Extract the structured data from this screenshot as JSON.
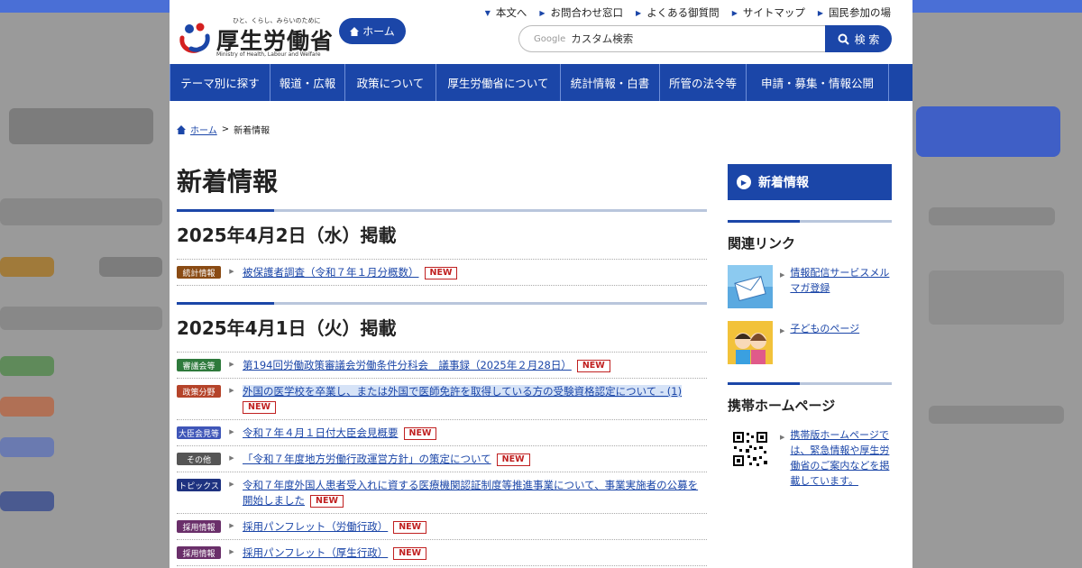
{
  "header": {
    "tagline": "ひと、くらし、みらいのために",
    "logo_name": "厚生労働省",
    "logo_english": "Ministry of Health, Labour and Welfare",
    "home_button": "ホーム",
    "utility_links": [
      "本文へ",
      "お問合わせ窓口",
      "よくある御質問",
      "サイトマップ",
      "国民参加の場"
    ],
    "search_brand": "Google",
    "search_value": "カスタム検索",
    "search_button": "検 索"
  },
  "nav": [
    "テーマ別に探す",
    "報道・広報",
    "政策について",
    "厚生労働省について",
    "統計情報・白書",
    "所管の法令等",
    "申請・募集・情報公開"
  ],
  "breadcrumb": {
    "home": "ホーム",
    "separator": ">",
    "current": "新着情報"
  },
  "main": {
    "title": "新着情報",
    "new_label": "NEW",
    "sections": [
      {
        "date": "2025年4月2日（水）掲載",
        "items": [
          {
            "category": "統計情報",
            "color": "#8a4b14",
            "text": "被保護者調査（令和７年１月分概数）"
          }
        ]
      },
      {
        "date": "2025年4月1日（火）掲載",
        "items": [
          {
            "category": "審議会等",
            "color": "#2e7a3c",
            "text": "第194回労働政策審議会労働条件分科会　議事録（2025年２月28日）"
          },
          {
            "category": "政策分野",
            "color": "#b5442a",
            "text": "外国の医学校を卒業し、または外国で医師免許を取得している方の受験資格認定について - (1)"
          },
          {
            "category": "大臣会見等",
            "color": "#3f56b8",
            "text": "令和７年４月１日付大臣会見概要"
          },
          {
            "category": "その他",
            "color": "#555555",
            "text": "「令和７年度地方労働行政運営方針」の策定について"
          },
          {
            "category": "トピックス",
            "color": "#1e3280",
            "text": "令和７年度外国人患者受入れに資する医療機関認証制度等推進事業について、事業実施者の公募を開始しました"
          },
          {
            "category": "採用情報",
            "color": "#6a2f6a",
            "text": "採用パンフレット（労働行政）"
          },
          {
            "category": "採用情報",
            "color": "#6a2f6a",
            "text": "採用パンフレット（厚生行政）"
          }
        ]
      }
    ]
  },
  "sidebar": {
    "current": "新着情報",
    "related_title": "関連リンク",
    "related_links": [
      "情報配信サービスメルマガ登録",
      "子どものページ"
    ],
    "mobile_title": "携帯ホームページ",
    "mobile_text": "携帯版ホームページでは、緊急情報や厚生労働省のご案内などを掲載しています。"
  }
}
